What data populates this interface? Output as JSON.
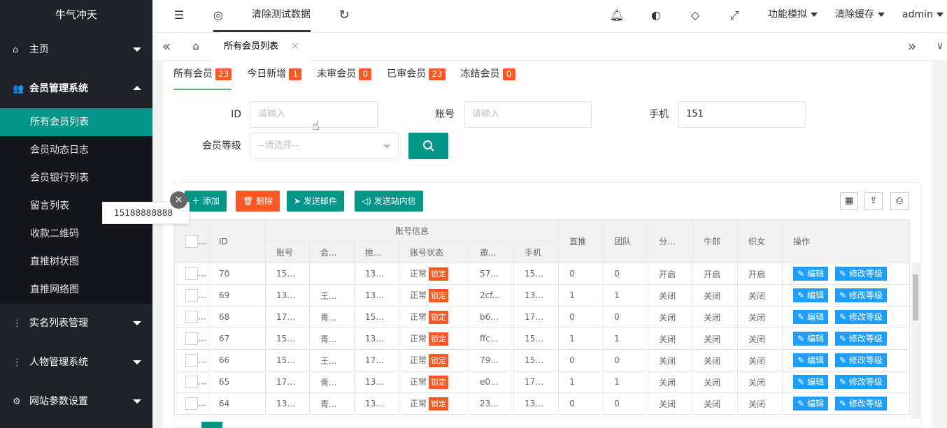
{
  "sidebar": {
    "logo": "牛气冲天",
    "groups": [
      {
        "icon": "⌂",
        "label": "主页"
      },
      {
        "icon": "👥",
        "label": "会员管理系统"
      },
      {
        "icon": "⋮",
        "label": "实名列表管理"
      },
      {
        "icon": "⋮",
        "label": "人物管理系统"
      },
      {
        "icon": "⚙",
        "label": "网站参数设置"
      }
    ],
    "sub_items": [
      "所有会员列表",
      "会员动态日志",
      "会员银行列表",
      "留言列表",
      "收款二维码",
      "直推树状图",
      "直推网络图"
    ]
  },
  "header": {
    "clear_test_data": "清除测试数据",
    "function_sim": "功能模拟",
    "clear_cache": "清除缓存",
    "user": "admin"
  },
  "tabbar": {
    "active_tab": "所有会员列表",
    "close": "×"
  },
  "status_tabs": [
    {
      "label": "所有会员",
      "count": "23"
    },
    {
      "label": "今日新增",
      "count": "1"
    },
    {
      "label": "未审会员",
      "count": "0"
    },
    {
      "label": "已审会员",
      "count": "23"
    },
    {
      "label": "冻结会员",
      "count": "0"
    }
  ],
  "form": {
    "id_label": "ID",
    "id_placeholder": "请输入",
    "account_label": "账号",
    "account_placeholder": "请输入",
    "phone_label": "手机",
    "phone_value": "151",
    "level_label": "会员等级",
    "level_placeholder": "--请选择--"
  },
  "toolbar": {
    "add": "添加",
    "delete": "删除",
    "send_mail": "发送邮件",
    "send_msg": "发送站内信"
  },
  "table": {
    "headers": {
      "id": "ID",
      "account_info": "账号信息",
      "account": "账号",
      "member": "会...",
      "referrer": "推...",
      "status": "账号状态",
      "invite": "邀...",
      "phone": "手机",
      "direct": "直推",
      "team": "团队",
      "share": "分...",
      "cowherd": "牛郎",
      "weaver": "织女",
      "ops": "操作"
    },
    "rows": [
      {
        "id": "70",
        "account": "15188888888",
        "member": "",
        "referrer": "132...",
        "status": "正常",
        "lock": "锁定",
        "invite": "57d...",
        "phone": "151...",
        "direct": "0",
        "team": "0",
        "share": "开启",
        "cowherd": "开启",
        "weaver": "开启"
      },
      {
        "id": "69",
        "account": "132...",
        "member": "王...",
        "referrer": "132...",
        "status": "正常",
        "lock": "锁定",
        "invite": "2cf...",
        "phone": "132...",
        "direct": "1",
        "team": "1",
        "share": "关闭",
        "cowherd": "关闭",
        "weaver": "关闭"
      },
      {
        "id": "68",
        "account": "173...",
        "member": "青...",
        "referrer": "157...",
        "status": "正常",
        "lock": "锁定",
        "invite": "b66...",
        "phone": "173...",
        "direct": "0",
        "team": "0",
        "share": "关闭",
        "cowherd": "关闭",
        "weaver": "关闭"
      },
      {
        "id": "67",
        "account": "157...",
        "member": "青...",
        "referrer": "132...",
        "status": "正常",
        "lock": "锁定",
        "invite": "ffccb0",
        "phone": "157...",
        "direct": "1",
        "team": "1",
        "share": "关闭",
        "cowherd": "关闭",
        "weaver": "关闭"
      },
      {
        "id": "66",
        "account": "151...",
        "member": "王...",
        "referrer": "171...",
        "status": "正常",
        "lock": "锁定",
        "invite": "79d...",
        "phone": "151...",
        "direct": "0",
        "team": "0",
        "share": "关闭",
        "cowherd": "关闭",
        "weaver": "关闭"
      },
      {
        "id": "65",
        "account": "171...",
        "member": "青...",
        "referrer": "132...",
        "status": "正常",
        "lock": "锁定",
        "invite": "e0c...",
        "phone": "171...",
        "direct": "1",
        "team": "1",
        "share": "关闭",
        "cowherd": "关闭",
        "weaver": "关闭"
      },
      {
        "id": "64",
        "account": "132...",
        "member": "青...",
        "referrer": "132...",
        "status": "正常",
        "lock": "锁定",
        "invite": "232...",
        "phone": "132...",
        "direct": "0",
        "team": "0",
        "share": "关闭",
        "cowherd": "关闭",
        "weaver": "关闭"
      }
    ],
    "edit": "编辑",
    "modify_level": "修改等级"
  },
  "tooltip": {
    "text": "15188888888"
  },
  "colors": {
    "sidebar": "#20222a",
    "accent": "#009688",
    "danger": "#ff5722",
    "info": "#1e9fff"
  }
}
